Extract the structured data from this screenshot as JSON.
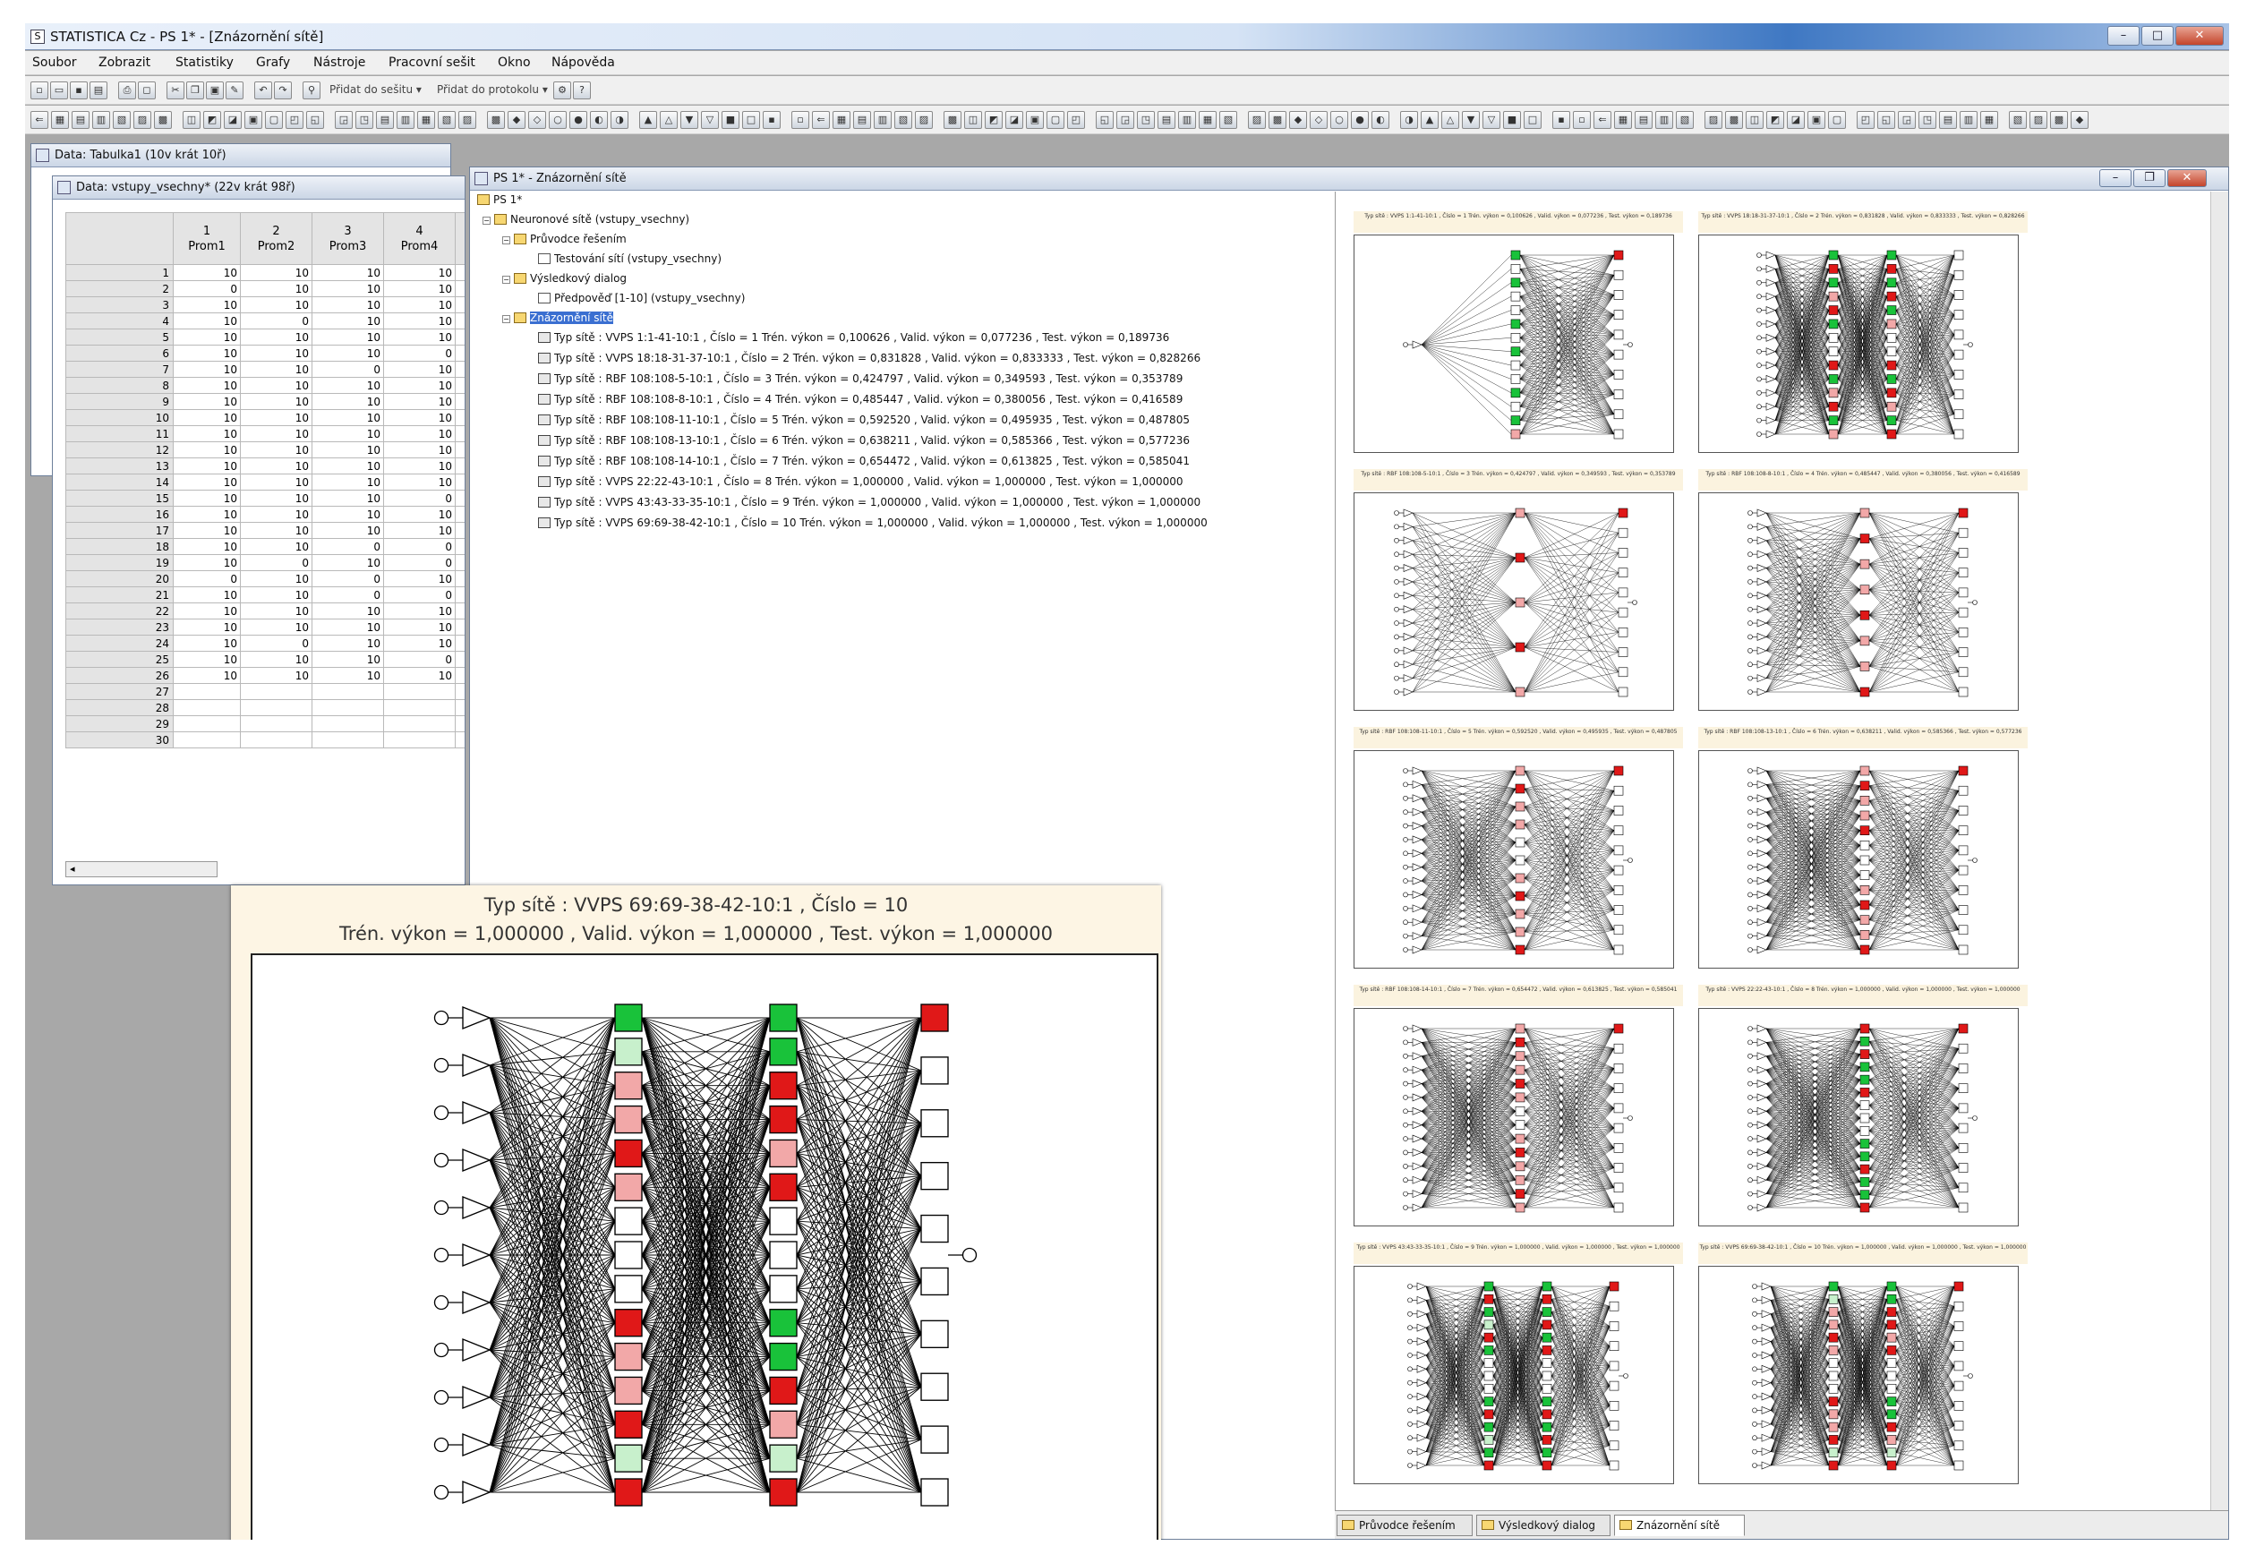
{
  "window": {
    "title": "STATISTICA Cz - PS 1* - [Znázornění sítě]"
  },
  "menu": [
    "Soubor",
    "Zobrazit",
    "Statistiky",
    "Grafy",
    "Nástroje",
    "Pracovní sešit",
    "Okno",
    "Nápověda"
  ],
  "toolbar": {
    "add_to_workbook": "Přidat do sešitu ▾",
    "add_to_report": "Přidat do protokolu ▾"
  },
  "windows": {
    "data_back": "Data: Tabulka1 (10v krát 10ř)",
    "data_front": "Data: vstupy_vsechny* (22v krát 98ř)",
    "ps1": "PS 1* - Znázornění sítě"
  },
  "spreadsheet": {
    "col_numbers": [
      "1",
      "2",
      "3",
      "4"
    ],
    "col_names": [
      "Prom1",
      "Prom2",
      "Prom3",
      "Prom4"
    ],
    "rows": [
      [
        "1",
        "10",
        "10",
        "10",
        "10"
      ],
      [
        "2",
        "0",
        "10",
        "10",
        "10"
      ],
      [
        "3",
        "10",
        "10",
        "10",
        "10"
      ],
      [
        "4",
        "10",
        "0",
        "10",
        "10"
      ],
      [
        "5",
        "10",
        "10",
        "10",
        "10"
      ],
      [
        "6",
        "10",
        "10",
        "10",
        "0"
      ],
      [
        "7",
        "10",
        "10",
        "0",
        "10"
      ],
      [
        "8",
        "10",
        "10",
        "10",
        "10"
      ],
      [
        "9",
        "10",
        "10",
        "10",
        "10"
      ],
      [
        "10",
        "10",
        "10",
        "10",
        "10"
      ],
      [
        "11",
        "10",
        "10",
        "10",
        "10"
      ],
      [
        "12",
        "10",
        "10",
        "10",
        "10"
      ],
      [
        "13",
        "10",
        "10",
        "10",
        "10"
      ],
      [
        "14",
        "10",
        "10",
        "10",
        "10"
      ],
      [
        "15",
        "10",
        "10",
        "10",
        "0"
      ],
      [
        "16",
        "10",
        "10",
        "10",
        "10"
      ],
      [
        "17",
        "10",
        "10",
        "10",
        "10"
      ],
      [
        "18",
        "10",
        "10",
        "0",
        "0"
      ],
      [
        "19",
        "10",
        "0",
        "10",
        "0"
      ],
      [
        "20",
        "0",
        "10",
        "0",
        "10"
      ],
      [
        "21",
        "10",
        "10",
        "0",
        "0"
      ],
      [
        "22",
        "10",
        "10",
        "10",
        "10"
      ],
      [
        "23",
        "10",
        "10",
        "10",
        "10"
      ],
      [
        "24",
        "10",
        "0",
        "10",
        "10"
      ],
      [
        "25",
        "10",
        "10",
        "10",
        "0"
      ],
      [
        "26",
        "10",
        "10",
        "10",
        "10"
      ],
      [
        "27",
        "",
        "",
        " ",
        ""
      ],
      [
        "28",
        "",
        "",
        "",
        ""
      ],
      [
        "29",
        "",
        "",
        "",
        ""
      ],
      [
        "30",
        "",
        "",
        "",
        ""
      ]
    ]
  },
  "tree": {
    "root": "PS 1*",
    "n1": "Neuronové sítě (vstupy_vsechny)",
    "n2": "Průvodce řešením",
    "n3": "Testování sítí (vstupy_vsechny)",
    "n4": "Výsledkový dialog",
    "n5": "Předpověď [1-10] (vstupy_vsechny)",
    "n6": "Znázornění sítě",
    "nets": [
      "Typ sítě : VVPS 1:1-41-10:1 ,  Číslo = 1 Trén. výkon = 0,100626 ,  Valid. výkon = 0,077236 ,  Test. výkon = 0,189736",
      "Typ sítě : VVPS 18:18-31-37-10:1 ,  Číslo = 2 Trén. výkon = 0,831828 ,  Valid. výkon = 0,833333 ,  Test. výkon = 0,828266",
      "Typ sítě : RBF 108:108-5-10:1 ,  Číslo = 3 Trén. výkon = 0,424797 ,  Valid. výkon = 0,349593 ,  Test. výkon = 0,353789",
      "Typ sítě : RBF 108:108-8-10:1 ,  Číslo = 4 Trén. výkon = 0,485447 ,  Valid. výkon = 0,380056 ,  Test. výkon = 0,416589",
      "Typ sítě : RBF 108:108-11-10:1 ,  Číslo = 5 Trén. výkon = 0,592520 ,  Valid. výkon = 0,495935 ,  Test. výkon = 0,487805",
      "Typ sítě : RBF 108:108-13-10:1 ,  Číslo = 6 Trén. výkon = 0,638211 ,  Valid. výkon = 0,585366 ,  Test. výkon = 0,577236",
      "Typ sítě : RBF 108:108-14-10:1 ,  Číslo = 7 Trén. výkon = 0,654472 ,  Valid. výkon = 0,613825 ,  Test. výkon = 0,585041",
      "Typ sítě : VVPS 22:22-43-10:1 ,  Číslo = 8 Trén. výkon = 1,000000 ,  Valid. výkon = 1,000000 ,  Test. výkon = 1,000000",
      "Typ sítě : VVPS 43:43-33-35-10:1 ,  Číslo = 9 Trén. výkon = 1,000000 ,  Valid. výkon = 1,000000 ,  Test. výkon = 1,000000",
      "Typ sítě : VVPS 69:69-38-42-10:1 ,  Číslo = 10 Trén. výkon = 1,000000 ,  Valid. výkon = 1,000000 ,  Test. výkon = 1,000000"
    ]
  },
  "tabs": [
    "Průvodce řešením",
    "Výsledkový dialog",
    "Znázornění sítě"
  ],
  "big_chart": {
    "line1": "Typ sítě : VVPS 69:69-38-42-10:1 ,  Číslo = 10",
    "line2": "Trén. výkon = 1,000000 ,  Valid. výkon = 1,000000 ,  Test. výkon = 1,000000"
  },
  "colors": {
    "green": "#19c23a",
    "red": "#e01818",
    "pink": "#f2a8a8",
    "light_green": "#c8f0cc"
  }
}
